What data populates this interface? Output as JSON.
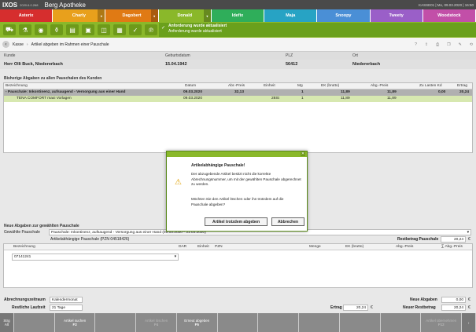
{
  "window": {
    "app": "IXOS",
    "version": "2020.6.0.268",
    "pharmacy": "Berg Apotheke",
    "status": "KASSE01 | Mo, 09.03.2020 | 16:50"
  },
  "users": [
    {
      "name": "Asterix",
      "color": "#d62e2e",
      "dropdown": false
    },
    {
      "name": "Charly",
      "color": "#e8a01c",
      "dropdown": true
    },
    {
      "name": "Dagobert",
      "color": "#e07a14",
      "dropdown": true
    },
    {
      "name": "Donald",
      "color": "#8ab82a",
      "dropdown": true,
      "active": true
    },
    {
      "name": "Idefix",
      "color": "#2fae5a",
      "dropdown": false
    },
    {
      "name": "Maja",
      "color": "#27a3c4",
      "dropdown": false
    },
    {
      "name": "Snoopy",
      "color": "#4a8fd6",
      "dropdown": false
    },
    {
      "name": "Tweety",
      "color": "#9a5fc8",
      "dropdown": false
    },
    {
      "name": "Woodstock",
      "color": "#c24fa8",
      "dropdown": false
    }
  ],
  "notice": {
    "line1": "Anforderung wurde aktualisiert",
    "line2": "Anforderung wurde aktualisiert"
  },
  "breadcrumb": {
    "root": "Kasse",
    "page": "Artikel abgeben im Rahmen einer Pauschale"
  },
  "customer": {
    "headers": {
      "kunde": "Kunde",
      "geburtsdatum": "Geburtsdatum",
      "plz": "PLZ",
      "ort": "Ort"
    },
    "name": "Herr Olli Buck, Niedererbach",
    "geburtsdatum": "15.04.1942",
    "plz": "56412",
    "ort": "Niedererbach"
  },
  "past": {
    "title": "Bisherige Abgaben zu allen Pauschalen des Kunden",
    "headers": {
      "bez": "Bezeichnung",
      "datum": "Datum",
      "abr": "Abr.-Preis",
      "einheit": "Einheit",
      "mg": "Mg",
      "ek": "EK (brutto)",
      "abg": "Abg.-Preis",
      "zu": "Zu Lasten Kd",
      "ertrag": "Ertrag"
    },
    "group": {
      "bez": "- Pauschale: Inkontinenz, aufsaugend - Versorgung aus einer Hand",
      "datum": "09.03.2020",
      "abr": "32,13",
      "mg": "1",
      "ek": "11,89",
      "abg": "11,89",
      "zu": "0,00",
      "ertrag": "20,24"
    },
    "item": {
      "bez": "TENA COMFORT maxi Vorlagen",
      "datum": "09.03.2020",
      "einheit": "28St",
      "mg": "1",
      "ek": "11,89",
      "abg": "11,89"
    }
  },
  "dialog": {
    "title": "Artikelabhängige Pauschale!",
    "msg1": "Der abzugebende Artikel besitzt nicht die korrekte Abrechnungsnummer, um mit der gewählten Pauschale abgerechnet zu werden.",
    "msg2": "Möchten Sie den Artikel löschen oder ihn trotzdem auf die Pauschale abgeben?",
    "btn_ok": "Artikel trotzdem abgeben",
    "btn_cancel": "Abbrechen"
  },
  "neu": {
    "title": "Neue Abgaben zur gewählten Pauschale",
    "gew_label": "Gewählte Pauschale",
    "gew_value": "Pauschale: Inkontinenz, aufsaugend - Versorgung aus einer Hand (09.03.2020 - 31.03.2020)",
    "art_label": "Artikelabhängige Pauschale (PZN 04518426)",
    "restbetrag_label": "Restbetrag Pauschale",
    "restbetrag_value": "20,24",
    "currency": "€",
    "headers": {
      "bez": "Bezeichnung",
      "dar": "DAR",
      "einheit": "Einheit",
      "pzn": "PZN",
      "menge": "Menge",
      "ek": "EK (brutto)",
      "abg": "Abg.-Preis",
      "sum": "∑ Abg.-Preis"
    },
    "input_value": "07141241"
  },
  "footer": {
    "abr_label": "Abrechnungszeitraum",
    "abr_value": "Kalendermonat",
    "rest_label": "Restliche Laufzeit",
    "rest_value": "21 Tage",
    "ertrag_label": "Ertrag",
    "ertrag_value": "20,24",
    "neue_label": "Neue Abgaben",
    "neue_value": "0,00",
    "neuer_rest_label": "Neuer Restbetrag",
    "neuer_rest_value": "20,24"
  },
  "fkeys": {
    "strg": "Strg",
    "alt": "Alt",
    "f2_label": "Artikel suchen",
    "f2_key": "F2",
    "f4_label": "Artikel löschen",
    "f4_key": "F4",
    "f5_label": "Erneut abgeben",
    "f5_key": "F5",
    "f12_label": "Artikel übernehmen",
    "f12_key": "F12"
  }
}
